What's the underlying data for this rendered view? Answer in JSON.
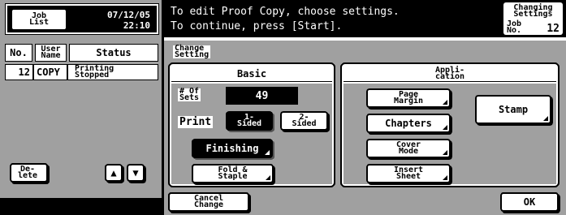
{
  "left": {
    "job_list_label": "Job\nList",
    "date": "07/12/05",
    "time": "22:10",
    "columns": [
      "No.",
      "User\nName",
      "Status"
    ],
    "rows": [
      {
        "no": "12",
        "user": "COPY",
        "status": "Printing\nStopped"
      }
    ],
    "delete_label": "De-\nlete",
    "up_arrow": "▲",
    "down_arrow": "▼"
  },
  "message": {
    "line1": "To edit Proof Copy, choose settings.",
    "line2": "To continue, press [Start].",
    "badge_title": "Changing\nSettings",
    "job_no_label": "Job\nNo.",
    "job_no": "12"
  },
  "change": {
    "heading": "Change\nSetting",
    "basic": {
      "title": "Basic",
      "sets_label": "# Of\nSets",
      "sets_value": "49",
      "print_label": "Print",
      "one_sided": "1-\nSided",
      "two_sided": "2-\nSided",
      "finishing": "Finishing",
      "fold_staple": "Fold &\nStaple"
    },
    "application": {
      "title": "Appli-\ncation",
      "page_margin": "Page\nMargin",
      "stamp": "Stamp",
      "chapters": "Chapters",
      "cover_mode": "Cover\nMode",
      "insert_sheet": "Insert\nSheet"
    },
    "cancel_change": "Cancel\nChange",
    "ok": "OK"
  }
}
